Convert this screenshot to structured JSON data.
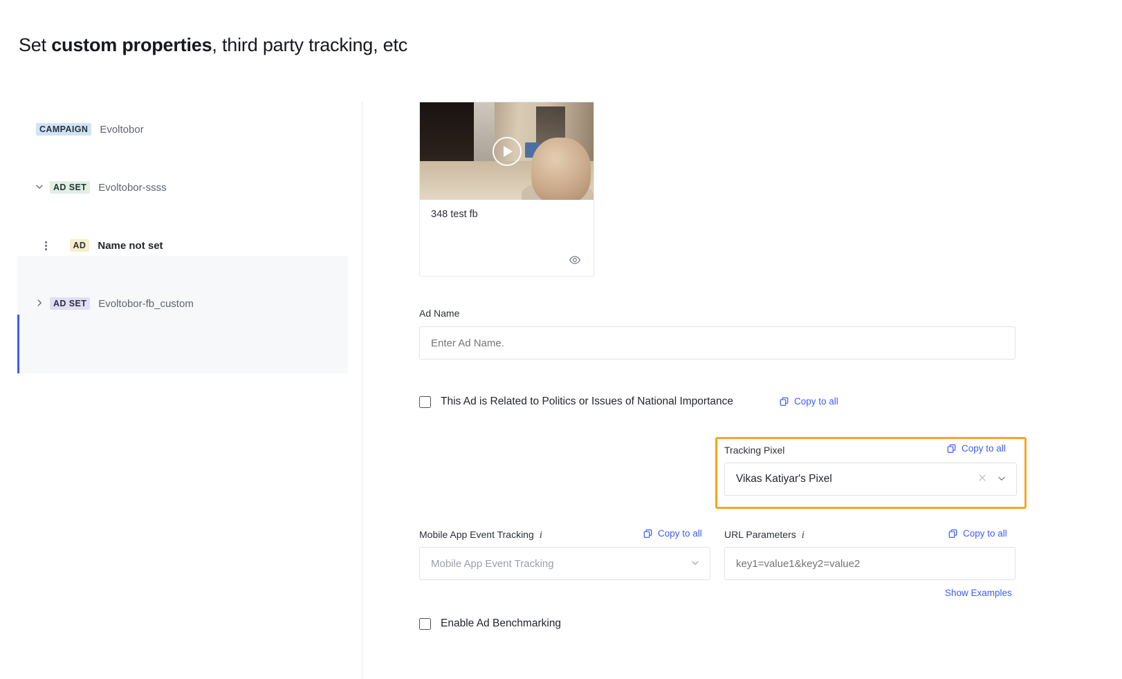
{
  "header": {
    "title_prefix": "Set ",
    "title_bold": "custom properties",
    "title_suffix": ", third party tracking, etc"
  },
  "tree": {
    "items": [
      {
        "badge": "CAMPAIGN",
        "label": "Evoltobor",
        "badge_color": "#cfe3f7",
        "expander": "",
        "selected": false
      },
      {
        "badge": "AD SET",
        "label": "Evoltobor-ssss",
        "badge_color": "#dff0e3",
        "expander": "chevron-down",
        "selected": false
      },
      {
        "badge": "AD",
        "label": "Name not set",
        "badge_color": "#f6eecb",
        "expander": "kebab-menu",
        "selected": true
      },
      {
        "badge": "AD SET",
        "label": "Evoltobor-fb_custom",
        "badge_color": "#e2ddf5",
        "expander": "chevron-right",
        "selected": false
      }
    ]
  },
  "media": {
    "title": "348 test fb",
    "play_icon": "play-icon",
    "preview_icon": "eye-icon"
  },
  "form": {
    "ad_name": {
      "label": "Ad Name",
      "value": "",
      "placeholder": "Enter Ad Name."
    },
    "politics": {
      "label": "This Ad is Related to Politics or Issues of National Importance",
      "checked": false
    },
    "tracking_pixel": {
      "label": "Tracking Pixel",
      "value": "Vikas Katiyar's Pixel",
      "clear_icon": "close-icon",
      "dropdown_icon": "chevron-down-icon",
      "highlight_color": "#f5a623"
    },
    "mobile_app_event_tracking": {
      "label": "Mobile App Event Tracking",
      "info_icon": "info-icon",
      "value": "",
      "placeholder": "Mobile App Event Tracking"
    },
    "url_parameters": {
      "label": "URL Parameters",
      "info_icon": "info-icon",
      "value": "",
      "placeholder": "key1=value1&key2=value2"
    },
    "show_examples": "Show Examples",
    "benchmarking": {
      "label": "Enable Ad Benchmarking",
      "checked": false
    },
    "copy_to_all_label": "Copy to all"
  },
  "colors": {
    "link": "#3d5afe",
    "highlight": "#f5a623",
    "active_bar": "#3d5afe"
  }
}
